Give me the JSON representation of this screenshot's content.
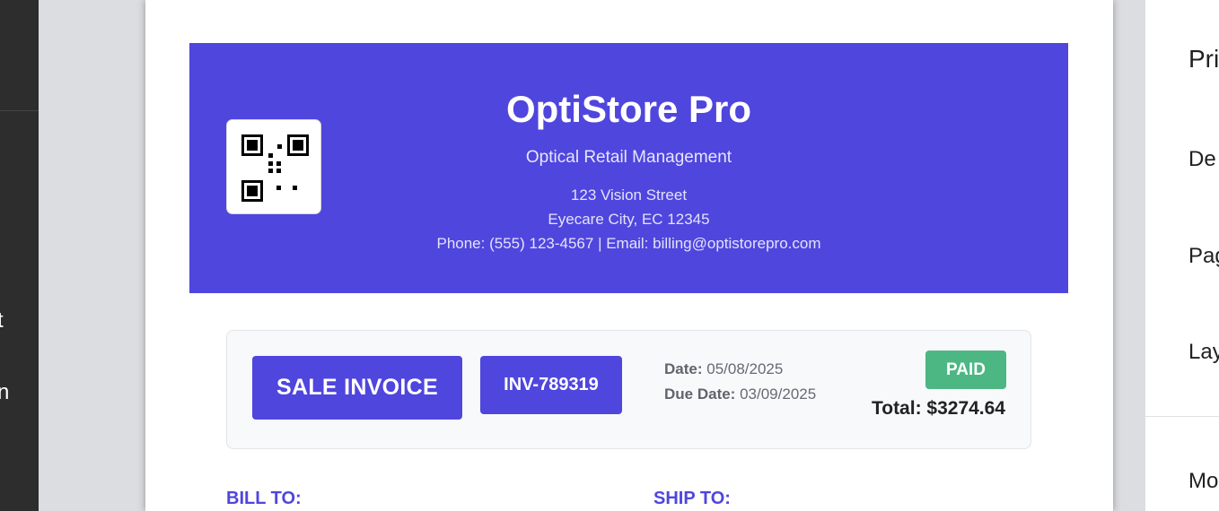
{
  "left_panel": {
    "fragments": [
      "t",
      "n"
    ]
  },
  "header": {
    "company_name": "OptiStore Pro",
    "tagline": "Optical Retail Management",
    "address_line1": "123 Vision Street",
    "address_line2": "Eyecare City, EC 12345",
    "contact": "Phone: (555) 123-4567 | Email: billing@optistorepro.com",
    "brand_color": "#4f46de",
    "qr_icon": "qr-code-icon"
  },
  "invoice": {
    "type_label": "SALE INVOICE",
    "number": "INV-789319",
    "date_label": "Date:",
    "date_value": "05/08/2025",
    "due_label": "Due Date:",
    "due_value": "03/09/2025",
    "status": "PAID",
    "status_color": "#4cb783",
    "total": "Total: $3274.64"
  },
  "parties": {
    "bill_to": "BILL TO:",
    "ship_to": "SHIP TO:"
  },
  "settings_panel": {
    "labels": [
      "Pri",
      "De",
      "Pag",
      "Lay",
      "Mo"
    ]
  }
}
